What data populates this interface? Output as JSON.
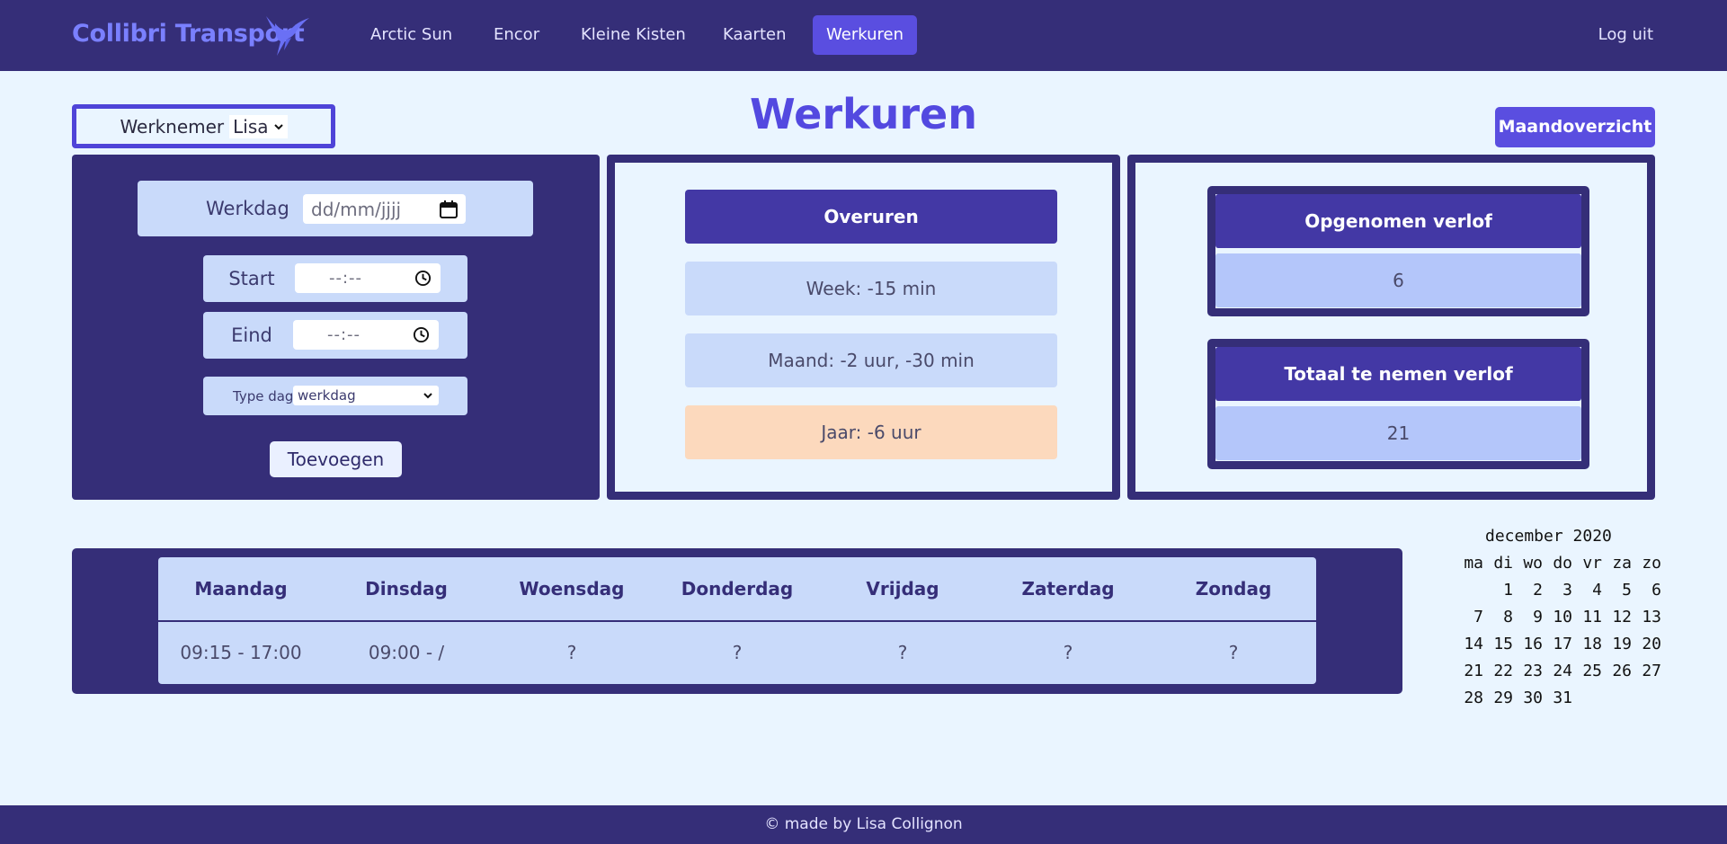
{
  "brand": "Collibri Transport",
  "nav": {
    "links": [
      "Arctic Sun",
      "Encor",
      "Kleine Kisten",
      "Kaarten",
      "Werkuren"
    ],
    "logout": "Log uit",
    "active": "Werkuren"
  },
  "employee": {
    "label": "Werknemer",
    "selected": "Lisa"
  },
  "page_title": "Werkuren",
  "month_button": "Maandoverzicht",
  "form": {
    "werkdag_label": "Werkdag",
    "werkdag_placeholder": "dd/mm/jjjj",
    "start_label": "Start",
    "start_placeholder": "--:--",
    "eind_label": "Eind",
    "eind_placeholder": "--:--",
    "type_label": "Type dag",
    "type_value": "werkdag",
    "add_button": "Toevoegen"
  },
  "overuren": {
    "title": "Overuren",
    "week": "Week: -15 min",
    "maand": "Maand: -2 uur, -30 min",
    "jaar": "Jaar: -6 uur"
  },
  "verlof": {
    "opgenomen_label": "Opgenomen verlof",
    "opgenomen_value": "6",
    "totaal_label": "Totaal te nemen verlof",
    "totaal_value": "21"
  },
  "week_table": {
    "days": [
      "Maandag",
      "Dinsdag",
      "Woensdag",
      "Donderdag",
      "Vrijdag",
      "Zaterdag",
      "Zondag"
    ],
    "hours": [
      "09:15 - 17:00",
      "09:00 - /",
      "?",
      "?",
      "?",
      "?",
      "?"
    ]
  },
  "mini_calendar": {
    "title": "december 2020",
    "weekdays": [
      "ma",
      "di",
      "wo",
      "do",
      "vr",
      "za",
      "zo"
    ],
    "first_weekday_index": 1,
    "days_in_month": 31
  },
  "footer": "© made by Lisa Collignon",
  "colors": {
    "nav_bg": "#352e78",
    "accent": "#5a4ee0",
    "brand": "#7a80ff",
    "page_bg": "#eaf5ff",
    "jaar_highlight": "#fcd9bd"
  }
}
